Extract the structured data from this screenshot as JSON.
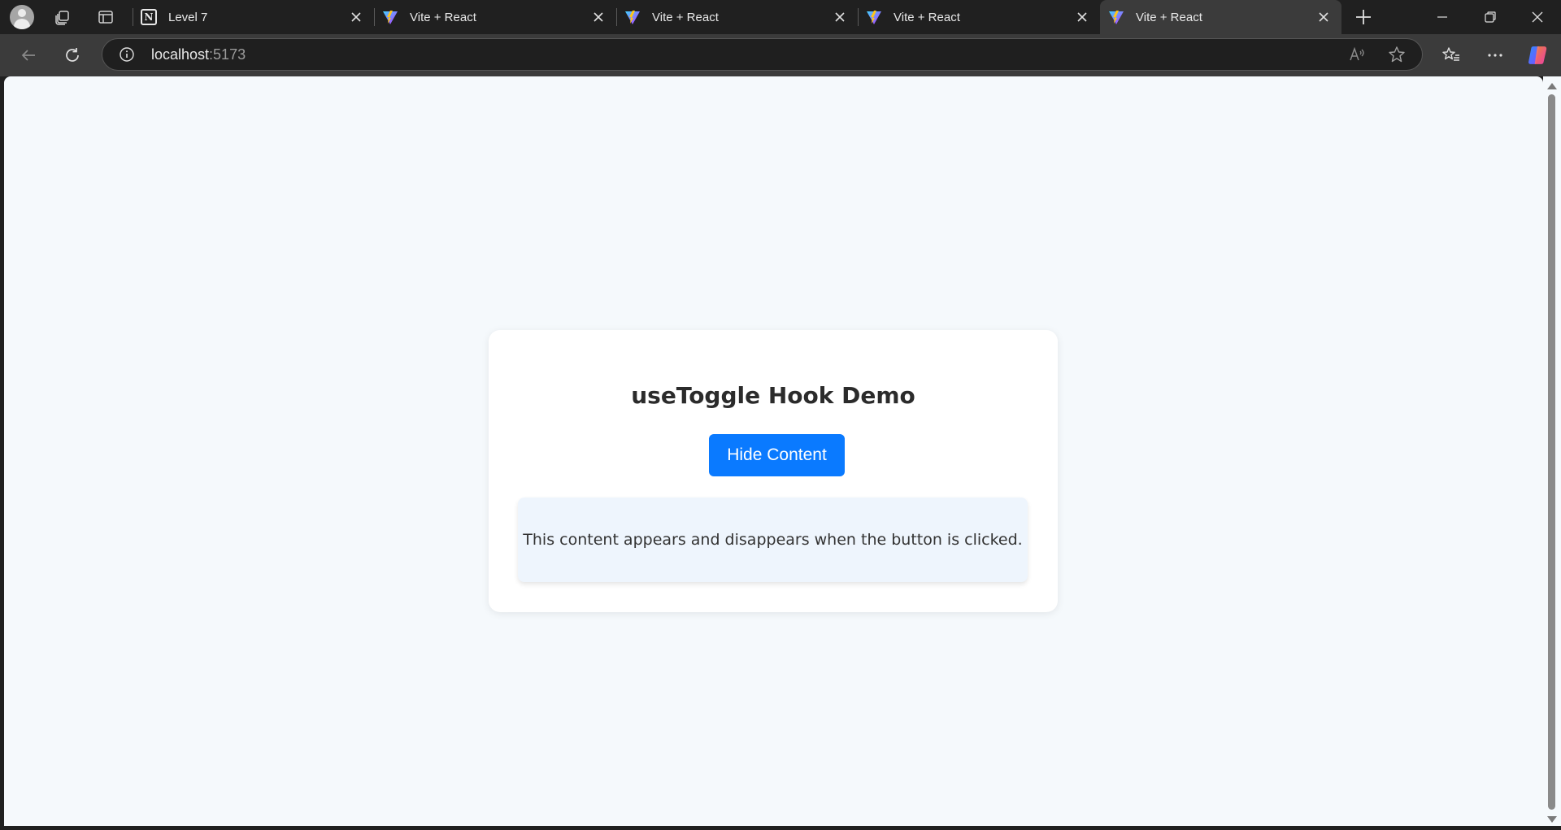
{
  "browser": {
    "tabs": [
      {
        "title": "Level 7",
        "favicon": "notion-icon",
        "active": false
      },
      {
        "title": "Vite + React",
        "favicon": "vite-icon",
        "active": false
      },
      {
        "title": "Vite + React",
        "favicon": "vite-icon",
        "active": false
      },
      {
        "title": "Vite + React",
        "favicon": "vite-icon",
        "active": false
      },
      {
        "title": "Vite + React",
        "favicon": "vite-icon",
        "active": true
      }
    ],
    "address": {
      "host": "localhost",
      "port": ":5173"
    },
    "colors": {
      "frame": "#202020",
      "toolbar": "#3b3b3b",
      "page_background": "#f5f9fc",
      "accent_button": "#0a7aff"
    }
  },
  "page": {
    "title": "useToggle Hook Demo",
    "toggle_button_label": "Hide Content",
    "content_text": "This content appears and disappears when the button is clicked."
  }
}
